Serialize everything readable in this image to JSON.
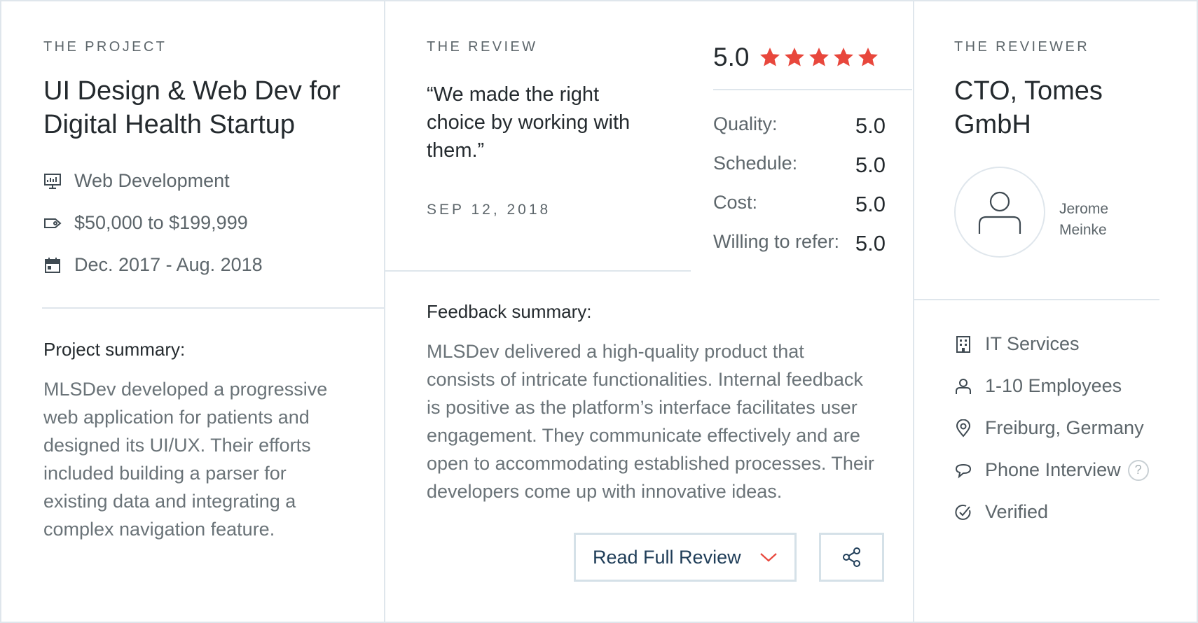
{
  "project": {
    "eyebrow": "THE PROJECT",
    "title_line1": "UI Design & Web Dev for",
    "title_line2": "Digital Health Startup",
    "meta": [
      {
        "icon": "presentation-board-icon",
        "text": "Web Development"
      },
      {
        "icon": "price-tag-icon",
        "text": "$50,000 to $199,999"
      },
      {
        "icon": "calendar-icon",
        "text": "Dec. 2017 - Aug. 2018"
      }
    ],
    "summary_heading": "Project summary:",
    "summary_lines": [
      "MLSDev developed a progressive",
      "web application for patients and",
      "designed its UI/UX. Their efforts",
      "included building a parser for",
      "existing data and integrating a",
      "complex navigation feature."
    ]
  },
  "review": {
    "eyebrow": "THE REVIEW",
    "quote_lines": [
      "“We made the right",
      "choice by working with",
      "them.”"
    ],
    "date": "SEP 12, 2018",
    "overall_score": "5.0",
    "stars": 5,
    "star_color": "#e8473c",
    "ratings": [
      {
        "label": "Quality:",
        "value": "5.0"
      },
      {
        "label": "Schedule:",
        "value": "5.0"
      },
      {
        "label": "Cost:",
        "value": "5.0"
      },
      {
        "label": "Willing to refer:",
        "value": "5.0"
      }
    ],
    "feedback_heading": "Feedback summary:",
    "feedback_lines": [
      "MLSDev delivered a high-quality product that",
      "consists of intricate functionalities. Internal feedback",
      "is positive as the platform’s interface facilitates user",
      "engagement. They communicate effectively and are",
      "open to accommodating established processes. Their",
      "developers come up with innovative ideas."
    ],
    "read_button_label": "Read Full Review",
    "share_icon": "share-icon"
  },
  "reviewer": {
    "eyebrow": "THE REVIEWER",
    "title_line1": "CTO, Tomes",
    "title_line2": "GmbH",
    "name_line1": "Jerome",
    "name_line2": "Meinke",
    "meta": [
      {
        "icon": "building-icon",
        "text": "IT Services"
      },
      {
        "icon": "person-icon",
        "text": "1-10 Employees"
      },
      {
        "icon": "location-pin-icon",
        "text": "Freiburg, Germany"
      },
      {
        "icon": "chat-bubble-icon",
        "text": "Phone Interview"
      },
      {
        "icon": "check-circle-icon",
        "text": "Verified"
      }
    ],
    "help_glyph": "?"
  },
  "colors": {
    "border": "#dfe6ec",
    "text_dark": "#242a2e",
    "text_muted": "#5d666b",
    "accent": "#e8473c",
    "button_text": "#1f3d58"
  }
}
